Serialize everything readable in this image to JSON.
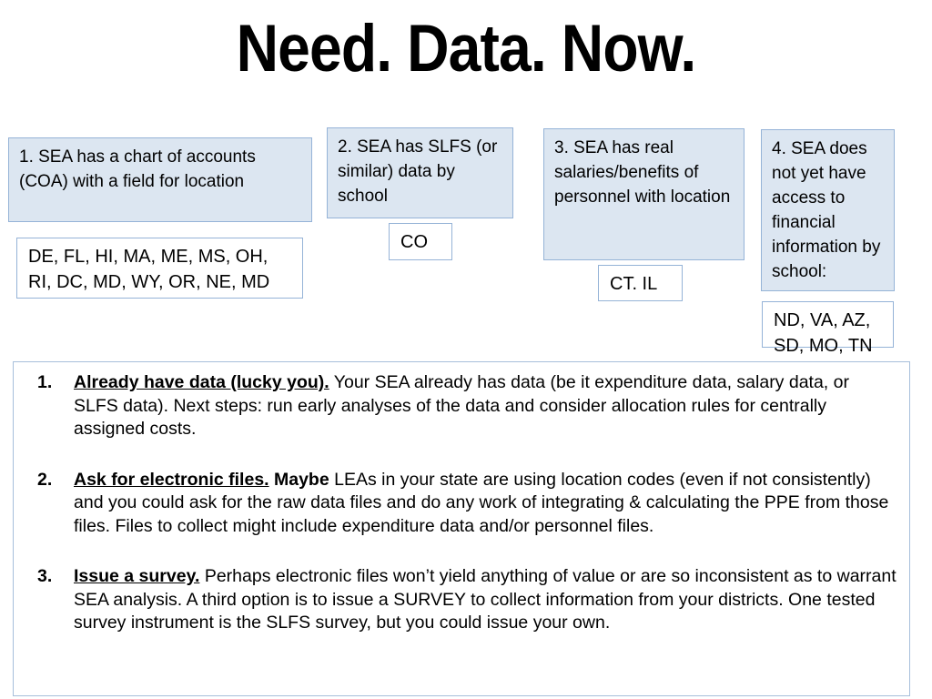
{
  "slide": {
    "title": "Need. Data. Now.",
    "colors": {
      "box_fill": "#dce6f1",
      "box_border": "#95b3d7",
      "body_border": "#a7bfdb",
      "text": "#000000"
    }
  },
  "categories": [
    {
      "id": "cat-1",
      "label": "1. SEA has a chart of accounts (COA) with a field for location",
      "states": "DE, FL, HI, MA, ME, MS, OH, RI, DC, MD, WY, OR, NE, MD"
    },
    {
      "id": "cat-2",
      "label": "2. SEA has SLFS (or similar) data by school",
      "states": "CO"
    },
    {
      "id": "cat-3",
      "label": "3. SEA has real salaries/benefits of personnel with location",
      "states": "CT. IL"
    },
    {
      "id": "cat-4",
      "label": "4. SEA does not yet have access to financial information by school:",
      "states": "ND, VA, AZ, SD, MO, TN"
    }
  ],
  "steps": [
    {
      "number": "1.",
      "lead_bold_underline": "Already have data (lucky you).",
      "lead_bold": "",
      "body": " Your SEA already has data (be it expenditure data, salary data, or SLFS data). Next steps: run early analyses of the data and consider allocation rules for centrally assigned costs."
    },
    {
      "number": "2.",
      "lead_bold_underline": "Ask for electronic files.",
      "lead_bold": " Maybe",
      "body": " LEAs in your state are using location codes (even if not consistently) and you could ask for the raw data files and do any work of integrating & calculating the PPE from those files. Files to collect might include expenditure data and/or personnel files."
    },
    {
      "number": "3.",
      "lead_bold_underline": "Issue a survey.",
      "lead_bold": "",
      "body": " Perhaps electronic files won’t yield anything of value or are so inconsistent as to warrant SEA analysis. A third option is to issue a SURVEY to collect information from your districts. One tested survey instrument is the SLFS survey, but you could issue your own."
    }
  ]
}
